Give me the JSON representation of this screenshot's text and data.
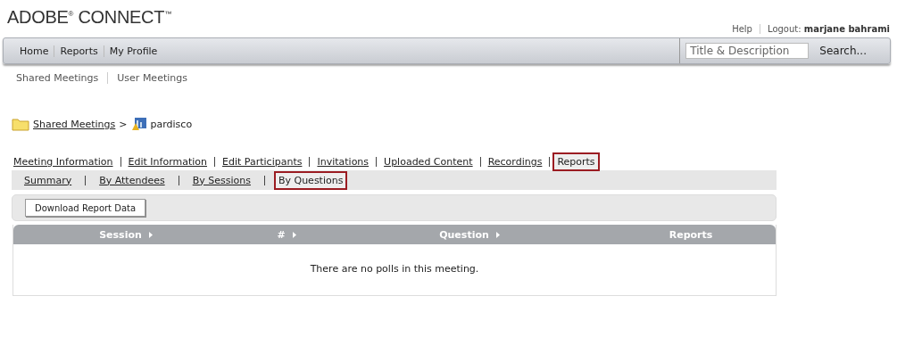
{
  "logo": "ADOBE$^{®}$ CONNECT$^{™}$",
  "top_links": {
    "help": "Help",
    "logout_label": "Logout:",
    "user": "marjane bahrami"
  },
  "nav": [
    {
      "label": "Home"
    },
    {
      "label": "Reports"
    },
    {
      "label": "My Profile"
    }
  ],
  "search": {
    "placeholder": "Title & Description",
    "button": "Search..."
  },
  "subnav": [
    {
      "label": "Shared Meetings"
    },
    {
      "label": "User Meetings"
    }
  ],
  "breadcrumb": {
    "parent": "Shared Meetings",
    "separator": ">",
    "current": "pardisco"
  },
  "tabs": [
    {
      "label": "Meeting Information",
      "selected": false
    },
    {
      "label": "Edit Information",
      "selected": false
    },
    {
      "label": "Edit Participants",
      "selected": false
    },
    {
      "label": "Invitations",
      "selected": false
    },
    {
      "label": "Uploaded Content",
      "selected": false
    },
    {
      "label": "Recordings",
      "selected": false
    },
    {
      "label": "Reports",
      "selected": true
    }
  ],
  "subtabs": [
    {
      "label": "Summary",
      "selected": false
    },
    {
      "label": "By Attendees",
      "selected": false
    },
    {
      "label": "By Sessions",
      "selected": false
    },
    {
      "label": "By Questions",
      "selected": true
    }
  ],
  "toolbar": {
    "button": "Download Report Data"
  },
  "table": {
    "columns": [
      {
        "label": "Session",
        "sortable": true
      },
      {
        "label": "#",
        "sortable": true
      },
      {
        "label": "Question",
        "sortable": true
      },
      {
        "label": "Reports",
        "sortable": false
      }
    ],
    "empty_message": "There are no polls in this meeting."
  }
}
